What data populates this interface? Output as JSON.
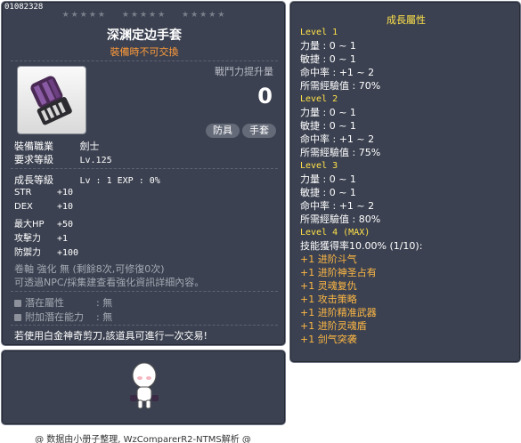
{
  "item": {
    "id": "01082328",
    "stars": [
      "★★★★★",
      "★★★★★",
      "★★★★★"
    ],
    "name": "深渊定边手套",
    "trade_note": "裝備時不可交換",
    "power_label": "戰鬥力提升量",
    "power_value": "0",
    "tags": [
      "防具",
      "手套"
    ],
    "job_label": "裝備職業",
    "job_value": "劍士",
    "req_level_label": "要求等級",
    "req_level_value": "Lv.125",
    "growth_label": "成長等級",
    "growth_value": "Lv : 1   EXP : 0%",
    "stats": [
      {
        "k": "STR",
        "v": "+10"
      },
      {
        "k": "DEX",
        "v": "+10"
      },
      {
        "k": "最大HP",
        "v": "+50"
      },
      {
        "k": "攻擊力",
        "v": "+1"
      },
      {
        "k": "防禦力",
        "v": "+100"
      }
    ],
    "scroll_line": "卷軸 強化 無 (剩餘8次,可修復0次)",
    "enhance_line": "可透過NPC/採集建查看強化資訊詳細內容。",
    "potential": [
      {
        "k": "潛在屬性",
        "v": ": 無"
      },
      {
        "k": "附加潛在能力",
        "v": ": 無"
      }
    ],
    "final_note": "若使用白金神奇剪刀,該道具可進行一次交易!"
  },
  "growth": {
    "title": "成長屬性",
    "lines": [
      {
        "t": "Level 1",
        "c": "lvl"
      },
      {
        "t": "力量 : 0 ~ 1",
        "c": "stat-line"
      },
      {
        "t": "敏捷 : 0 ~ 1",
        "c": "stat-line"
      },
      {
        "t": "命中率 : +1 ~ 2",
        "c": "stat-line"
      },
      {
        "t": "所需經驗值 : 70%",
        "c": "stat-line"
      },
      {
        "t": "Level 2",
        "c": "lvl"
      },
      {
        "t": "力量 : 0 ~ 1",
        "c": "stat-line"
      },
      {
        "t": "敏捷 : 0 ~ 1",
        "c": "stat-line"
      },
      {
        "t": "命中率 : +1 ~ 2",
        "c": "stat-line"
      },
      {
        "t": "所需經驗值 : 75%",
        "c": "stat-line"
      },
      {
        "t": "Level 3",
        "c": "lvl"
      },
      {
        "t": "力量 : 0 ~ 1",
        "c": "stat-line"
      },
      {
        "t": "敏捷 : 0 ~ 1",
        "c": "stat-line"
      },
      {
        "t": "命中率 : +1 ~ 2",
        "c": "stat-line"
      },
      {
        "t": "所需經驗值 : 80%",
        "c": "stat-line"
      },
      {
        "t": "Level 4 (MAX)",
        "c": "lvl"
      },
      {
        "t": "技能獲得率10.00% (1/10):",
        "c": "skill-rate"
      },
      {
        "t": "+1 进阶斗气",
        "c": "skill"
      },
      {
        "t": "+1 进阶神圣占有",
        "c": "skill"
      },
      {
        "t": "+1 灵魂复仇",
        "c": "skill"
      },
      {
        "t": "+1 攻击策略",
        "c": "skill"
      },
      {
        "t": "+1 进阶精准武器",
        "c": "skill"
      },
      {
        "t": "+1 进阶灵魂盾",
        "c": "skill"
      },
      {
        "t": "+1 剑气突袭",
        "c": "skill"
      }
    ]
  },
  "credit": "@ 数据由小册子整理, WzComparerR2-NTMS解析 @",
  "icons": {
    "item": "purple-glove-icon",
    "avatar": "character-preview-avatar"
  },
  "colors": {
    "panel_bg": "#3b4150",
    "gold": "#ffe14a",
    "orange": "#ff9a3a",
    "skill": "#ffb845"
  }
}
